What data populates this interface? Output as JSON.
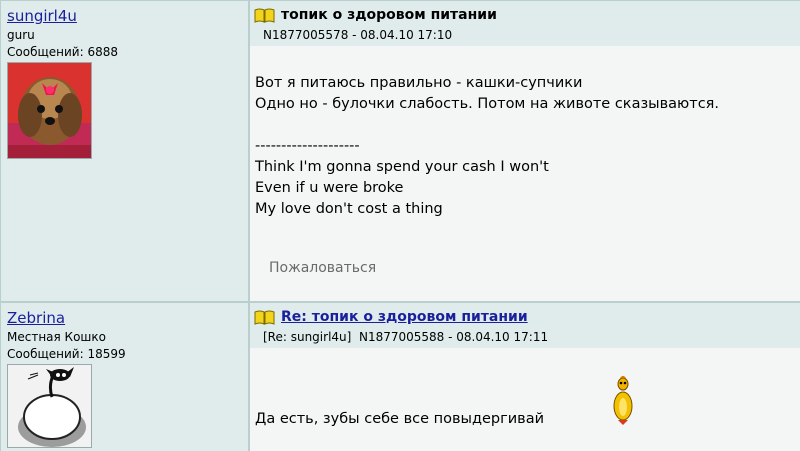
{
  "posts": [
    {
      "author": {
        "name": "sungirl4u",
        "rank": "guru",
        "posts_label": "Сообщений: 6888",
        "avatar": "yorkie-dog-avatar"
      },
      "title": "топик о здоровом питании",
      "meta": "N1877005578 - 08.04.10 17:10",
      "lines": [
        "Вот я питаюсь правильно - кашки-супчики",
        "Одно но - булочки слабость. Потом на животе сказываются.",
        "",
        "--------------------",
        "Think I'm gonna spend your cash I won't",
        "Even if u were broke",
        "My love don't cost a thing"
      ],
      "complain": "Пожаловаться"
    },
    {
      "author": {
        "name": "Zebrina",
        "rank": "Местная Кошко",
        "posts_label": "Сообщений: 18599",
        "avatar": "black-cat-on-egg-avatar"
      },
      "title": "Re: топик о здоровом питании",
      "reply_to": "[Re: sungirl4u]",
      "meta": "N1877005588 - 08.04.10 17:11",
      "lines": [
        "Да есть, зубы себе все повыдергивай"
      ],
      "emoticon": "yellow-chick-smiley"
    }
  ],
  "colors": {
    "link": "#1a1f9c",
    "header_bg": "#dfeceb",
    "body_bg": "#f4f6f6",
    "border": "#b9cfce"
  }
}
